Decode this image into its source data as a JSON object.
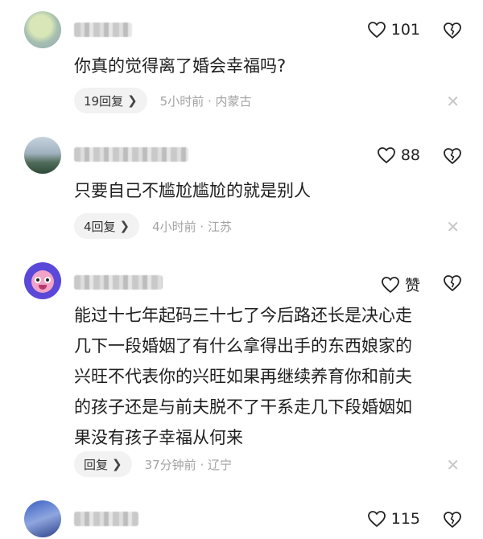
{
  "comments": [
    {
      "likes": "101",
      "text": "你真的觉得离了婚会幸福吗?",
      "reply_label": "19回复",
      "meta": "5小时前 · 内蒙古"
    },
    {
      "likes": "88",
      "text": "只要自己不尴尬尴尬的就是别人",
      "reply_label": "4回复",
      "meta": "4小时前 · 江苏"
    },
    {
      "likes": "赞",
      "text_lines": [
        "能过十七年起码三十七了今后路还长是决心走",
        "几下一段婚姻了有什么拿得出手的东西娘家的",
        "兴旺不代表你的兴旺如果再继续养育你和前夫",
        "的孩子还是与前夫脱不了干系走几下段婚姻如",
        "果没有孩子幸福从何来"
      ],
      "reply_label": "回复",
      "meta": "37分钟前 · 辽宁"
    },
    {
      "likes": "115"
    }
  ],
  "icons": {
    "like": "heart-outline-icon",
    "dislike": "broken-heart-icon",
    "close": "close-icon",
    "chevron": "chevron-right-icon"
  },
  "colors": {
    "text": "#1e1e1e",
    "meta": "#a3a3a3",
    "reply_bg": "#f2f2f2"
  }
}
